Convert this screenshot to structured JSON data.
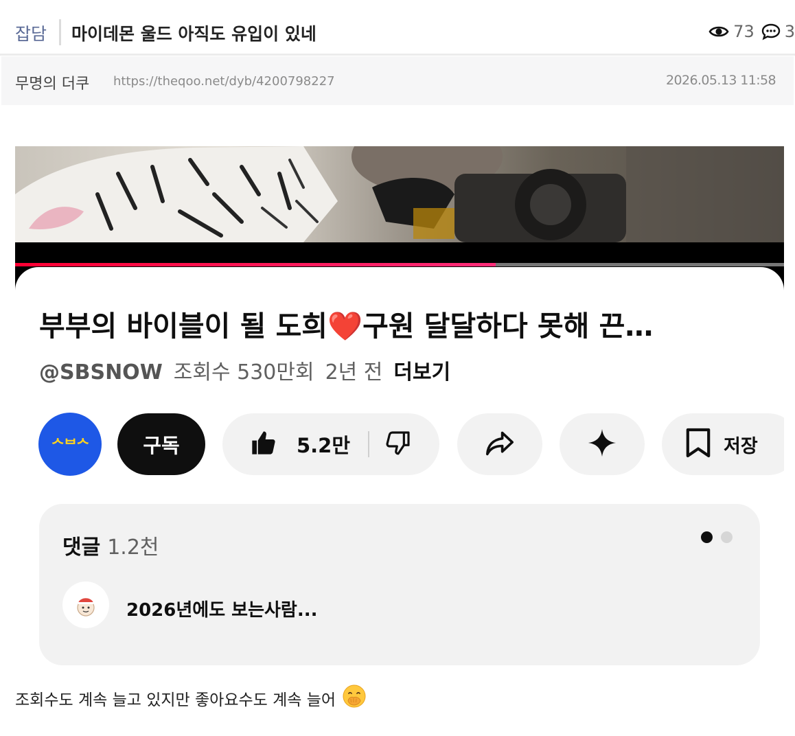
{
  "post": {
    "category": "잡담",
    "title": "마이데몬 울드 아직도 유입이 있네",
    "views": "73",
    "comments": "3",
    "author": "무명의 더쿠",
    "url": "https://theqoo.net/dyb/4200798227",
    "date": "2026.05.13 11:58"
  },
  "video": {
    "progress": 0.625,
    "title_before": "부부의 바이블이 될 도희",
    "title_heart": "❤️",
    "title_after": "구원 달달하다 못해 끈…",
    "channel_handle": "@SBSNOW",
    "view_count": "조회수 530만회",
    "age": "2년 전",
    "more_label": "더보기",
    "channel_logo_text": "ᄉᄇᄉ",
    "subscribe_label": "구독",
    "like_count": "5.2만",
    "save_label": "저장"
  },
  "comments_panel": {
    "label": "댓글",
    "count": "1.2천",
    "top_comment": "2026년에도 보는사람...",
    "page_dots": 2,
    "active_dot": 1
  },
  "body": {
    "text": "조회수도 계속 늘고 있지만 좋아요수도 계속 늘어"
  },
  "colors": {
    "category": "#5a6a96",
    "youtube_red": "#ff0033",
    "channel_blue": "#1e58e6",
    "logo_yellow": "#ffd21f"
  }
}
